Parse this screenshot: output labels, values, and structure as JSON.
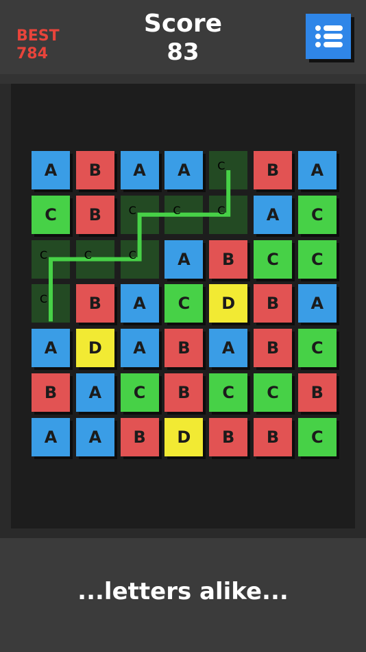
{
  "header": {
    "best_label": "BEST",
    "best_value": "784",
    "score_label": "Score",
    "score_value": "83",
    "menu_icon": "list-icon"
  },
  "board": {
    "rows": [
      [
        "A",
        "B",
        "A",
        "A",
        "C",
        "B",
        "A"
      ],
      [
        "C",
        "B",
        "C",
        "C",
        "C",
        "A",
        "C"
      ],
      [
        "C",
        "C",
        "C",
        "A",
        "B",
        "C",
        "C"
      ],
      [
        "C",
        "B",
        "A",
        "C",
        "D",
        "B",
        "A"
      ],
      [
        "A",
        "D",
        "A",
        "B",
        "A",
        "B",
        "C"
      ],
      [
        "B",
        "A",
        "C",
        "B",
        "C",
        "C",
        "B"
      ],
      [
        "A",
        "A",
        "B",
        "D",
        "B",
        "B",
        "C"
      ]
    ],
    "selected_path": [
      [
        0,
        4
      ],
      [
        1,
        4
      ],
      [
        1,
        3
      ],
      [
        1,
        2
      ],
      [
        2,
        2
      ],
      [
        2,
        1
      ],
      [
        2,
        0
      ],
      [
        3,
        0
      ]
    ],
    "colors": {
      "A": "#3a9de6",
      "B": "#e25353",
      "C": "#47d147",
      "D": "#f2ea33"
    }
  },
  "caption": "...letters alike..."
}
